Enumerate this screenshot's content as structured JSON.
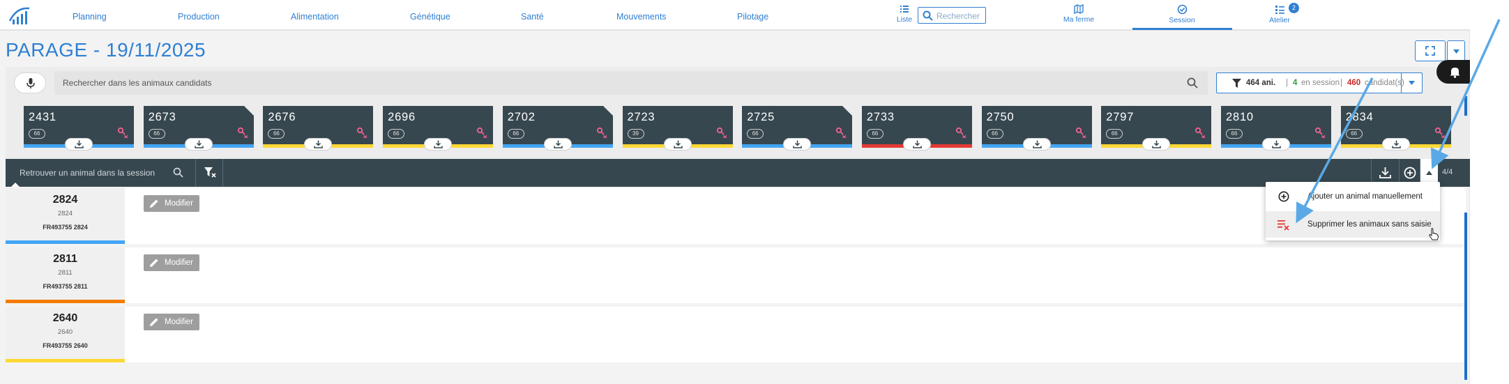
{
  "nav": {
    "items": [
      "Planning",
      "Production",
      "Alimentation",
      "Génétique",
      "Santé",
      "Mouvements",
      "Pilotage"
    ],
    "liste": "Liste",
    "search_placeholder": "Rechercher",
    "ma_ferme": "Ma ferme",
    "session": "Session",
    "atelier": "Atelier",
    "atelier_badge": "2"
  },
  "page": {
    "title": "PARAGE - 19/11/2025"
  },
  "search": {
    "placeholder": "Rechercher dans les animaux candidats",
    "filter": {
      "animals": "464 ani.",
      "sep1": "|",
      "in_session_count": "4",
      "in_session_label": "en session",
      "sep2": "|",
      "candidates_count": "460",
      "candidates_label": "candidat(s)"
    }
  },
  "cards": [
    {
      "num": "2431",
      "pill": "66",
      "color": "blue",
      "corner": false
    },
    {
      "num": "2673",
      "pill": "66",
      "color": "blue",
      "corner": true
    },
    {
      "num": "2676",
      "pill": "66",
      "color": "yellow",
      "corner": false
    },
    {
      "num": "2696",
      "pill": "66",
      "color": "yellow",
      "corner": false
    },
    {
      "num": "2702",
      "pill": "66",
      "color": "blue",
      "corner": true
    },
    {
      "num": "2723",
      "pill": "39",
      "color": "yellow",
      "corner": false
    },
    {
      "num": "2725",
      "pill": "66",
      "color": "blue",
      "corner": true
    },
    {
      "num": "2733",
      "pill": "66",
      "color": "red",
      "corner": false
    },
    {
      "num": "2750",
      "pill": "66",
      "color": "blue",
      "corner": false
    },
    {
      "num": "2797",
      "pill": "66",
      "color": "yellow",
      "corner": false
    },
    {
      "num": "2810",
      "pill": "66",
      "color": "blue",
      "corner": false
    },
    {
      "num": "2834",
      "pill": "66",
      "color": "yellow",
      "corner": false
    }
  ],
  "session": {
    "search_placeholder": "Retrouver un animal dans la session",
    "count": "4/4"
  },
  "rows": [
    {
      "num": "2824",
      "sub": "2824",
      "id": "FR493755  2824",
      "color": "#42a5f5",
      "button": "Modifier"
    },
    {
      "num": "2811",
      "sub": "2811",
      "id": "FR493755  2811",
      "color": "#f57c00",
      "button": "Modifier"
    },
    {
      "num": "2640",
      "sub": "2640",
      "id": "FR493755  2640",
      "color": "#fdd835",
      "button": "Modifier"
    }
  ],
  "menu": {
    "add": "Ajouter un animal manuellement",
    "delete": "Supprimer les animaux sans saisie"
  },
  "colors": {
    "accent": "#2f7fd1",
    "dark": "#37474f",
    "card_blue": "#42a5f5",
    "card_yellow": "#fdd835",
    "card_red": "#e53935"
  }
}
